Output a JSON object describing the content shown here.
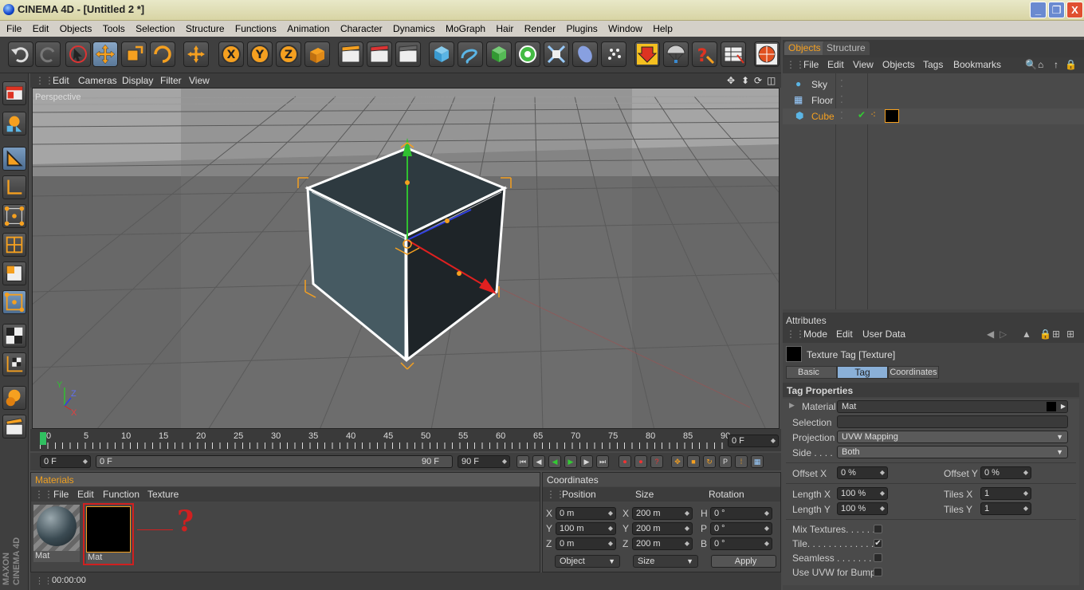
{
  "window": {
    "title": "CINEMA 4D - [Untitled 2 *]",
    "min": "_",
    "max": "❐",
    "close": "X"
  },
  "menu": [
    "File",
    "Edit",
    "Objects",
    "Tools",
    "Selection",
    "Structure",
    "Functions",
    "Animation",
    "Character",
    "Dynamics",
    "MoGraph",
    "Hair",
    "Render",
    "Plugins",
    "Window",
    "Help"
  ],
  "viewport": {
    "menu": [
      "Edit",
      "Cameras",
      "Display",
      "Filter",
      "View"
    ],
    "label": "Perspective",
    "axes": {
      "y": "Y",
      "z": "Z",
      "x": "X"
    }
  },
  "timeline": {
    "ticks": [
      "0",
      "5",
      "10",
      "15",
      "20",
      "25",
      "30",
      "35",
      "40",
      "45",
      "50",
      "55",
      "60",
      "65",
      "70",
      "75",
      "80",
      "85",
      "90"
    ],
    "current": "0 F",
    "start": "0 F",
    "range_start": "0 F",
    "range_end": "90 F",
    "end": "90 F"
  },
  "materials": {
    "title": "Materials",
    "menu": [
      "File",
      "Edit",
      "Function",
      "Texture"
    ],
    "items": [
      {
        "name": "Mat"
      },
      {
        "name": "Mat"
      }
    ],
    "annotation": "?"
  },
  "coordinates": {
    "title": "Coordinates",
    "headers": [
      "Position",
      "Size",
      "Rotation"
    ],
    "rows": [
      {
        "axis": "X",
        "pos": "0 m",
        "sz_axis": "X",
        "size": "200 m",
        "rot_axis": "H",
        "rot": "0 °"
      },
      {
        "axis": "Y",
        "pos": "100 m",
        "sz_axis": "Y",
        "size": "200 m",
        "rot_axis": "P",
        "rot": "0 °"
      },
      {
        "axis": "Z",
        "pos": "0 m",
        "sz_axis": "Z",
        "size": "200 m",
        "rot_axis": "B",
        "rot": "0 °"
      }
    ],
    "mode": "Object",
    "size_mode": "Size",
    "apply": "Apply"
  },
  "status": {
    "time": "00:00:00"
  },
  "objects_panel": {
    "tabs": [
      "Objects",
      "Structure"
    ],
    "menu": [
      "File",
      "Edit",
      "View",
      "Objects",
      "Tags",
      "Bookmarks"
    ],
    "items": [
      {
        "name": "Sky"
      },
      {
        "name": "Floor"
      },
      {
        "name": "Cube"
      }
    ]
  },
  "attributes": {
    "title": "Attributes",
    "menu": [
      "Mode",
      "Edit",
      "User Data"
    ],
    "object": "Texture Tag [Texture]",
    "tabs": [
      "Basic",
      "Tag",
      "Coordinates"
    ],
    "section": "Tag Properties",
    "material_label": "Material",
    "material_value": "Mat",
    "selection_label": "Selection",
    "projection_label": "Projection",
    "projection_value": "UVW Mapping",
    "side_label": "Side . . . .",
    "side_value": "Both",
    "offsetx_label": "Offset X",
    "offsetx": "0 %",
    "offsety_label": "Offset Y",
    "offsety": "0 %",
    "lengthx_label": "Length X",
    "lengthx": "100 %",
    "tilesx_label": "Tiles X",
    "tilesx": "1",
    "lengthy_label": "Length Y",
    "lengthy": "100 %",
    "tilesy_label": "Tiles Y",
    "tilesy": "1",
    "mix_label": "Mix Textures. . . . . .",
    "tile_label": "Tile. . . . . . . . . . . . .",
    "seamless_label": "Seamless . . . . . . . .",
    "uvwbump_label": "Use UVW for Bump",
    "tile_checked": "✔"
  },
  "colors": {
    "accent": "#f0a020",
    "active_tab": "#8ab0d8"
  }
}
